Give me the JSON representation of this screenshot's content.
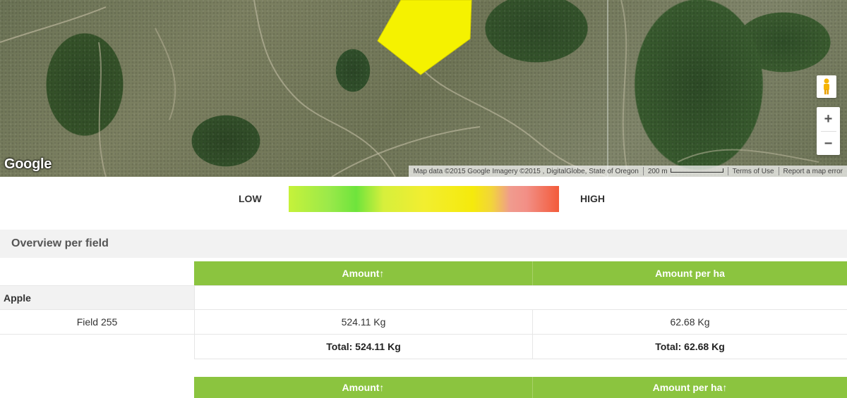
{
  "map": {
    "logo": "Google",
    "attribution": "Map data ©2015 Google Imagery ©2015 , DigitalGlobe, State of Oregon",
    "scale_label": "200 m",
    "terms": "Terms of Use",
    "report": "Report a map error",
    "zoom_in": "+",
    "zoom_out": "−",
    "polygon_color": "#f5f200"
  },
  "legend": {
    "low": "LOW",
    "high": "HIGH"
  },
  "overview": {
    "title": "Overview per field"
  },
  "table1": {
    "headers": [
      "Amount↑",
      "Amount per ha"
    ],
    "group": "Apple",
    "rows": [
      {
        "field": "Field 255",
        "amount": "524.11 Kg",
        "amount_per_ha": "62.68 Kg"
      }
    ],
    "total_amount": "Total: 524.11 Kg",
    "total_per_ha": "Total: 62.68 Kg"
  },
  "table2": {
    "headers": [
      "Amount↑",
      "Amount per ha↑"
    ]
  },
  "colors": {
    "header_green": "#8bc43f",
    "row_gray": "#f2f2f2"
  }
}
